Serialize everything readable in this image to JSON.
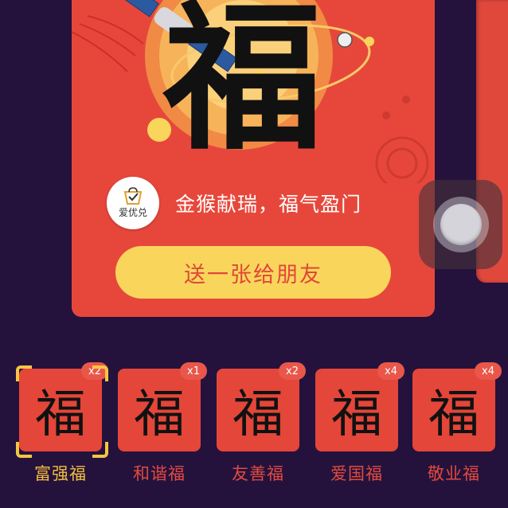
{
  "card": {
    "hero_char": "福",
    "brand_name": "爱优兑",
    "greeting": "金猴献瑞，福气盈门",
    "send_button": "送一张给朋友"
  },
  "fu_cards": [
    {
      "char": "福",
      "count": "x2",
      "label": "富强福",
      "selected": true
    },
    {
      "char": "福",
      "count": "x1",
      "label": "和谐福",
      "selected": false
    },
    {
      "char": "福",
      "count": "x2",
      "label": "友善福",
      "selected": false
    },
    {
      "char": "福",
      "count": "x4",
      "label": "爱国福",
      "selected": false
    },
    {
      "char": "福",
      "count": "x4",
      "label": "敬业福",
      "selected": false
    }
  ],
  "colors": {
    "background": "#24123d",
    "card_red": "#e7473b",
    "button_yellow": "#f9d65b",
    "selected_label": "#f3be3c",
    "label_red": "#e24a3e"
  }
}
